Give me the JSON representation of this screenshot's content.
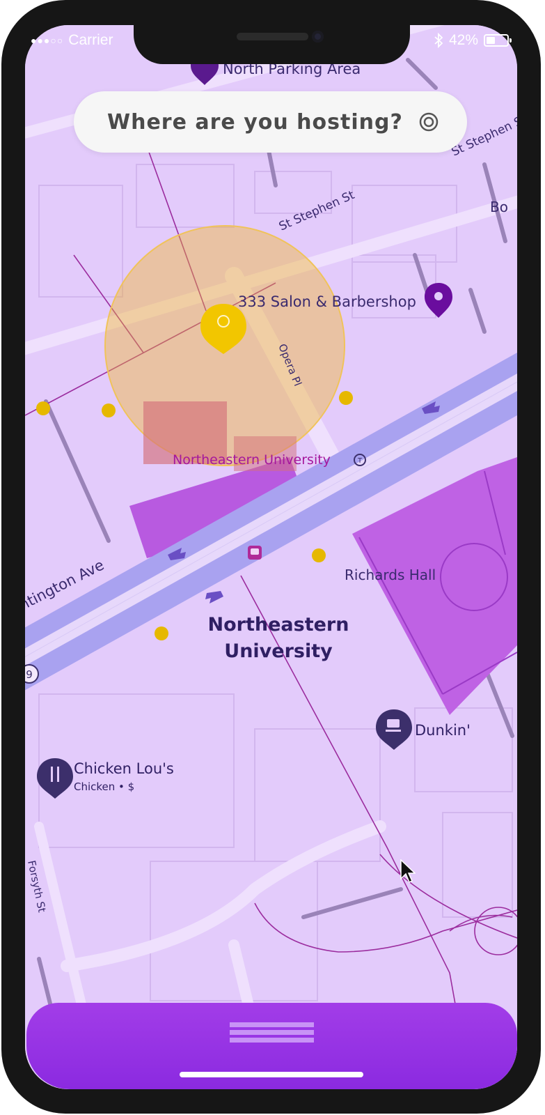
{
  "status_bar": {
    "signal": "●●●○○",
    "carrier": "Carrier",
    "bluetooth_icon": "bluetooth-icon",
    "battery_percent": "42%",
    "battery_level": 0.42
  },
  "search": {
    "placeholder": "Where are you hosting?",
    "locate_icon": "target-icon"
  },
  "map": {
    "labels": {
      "north_parking": "North Parking Area",
      "st_stephen_top": "St Stephen St",
      "st_stephen": "St Stephen St",
      "bo_partial": "Bo",
      "salon": "333 Salon & Barbershop",
      "opera_pl": "Opera Pl",
      "neu_station": "Northeastern University",
      "huntington": "ntington Ave",
      "richards_hall": "Richards Hall",
      "campus_line1": "Northeastern",
      "campus_line2": "University",
      "route_badge": "9",
      "dunkin": "Dunkin'",
      "chicken_name": "Chicken Lou's",
      "chicken_sub": "Chicken • $",
      "forsyth": "Forsyth St",
      "transit_symbol": "T"
    },
    "accent_colors": {
      "selection": "#f0b428",
      "marker": "#f0c000",
      "place_pin": "#6a0d9e",
      "panel": "#9b35e6"
    }
  },
  "bottom_sheet": {
    "handle_icon": "menu-handle-icon"
  }
}
